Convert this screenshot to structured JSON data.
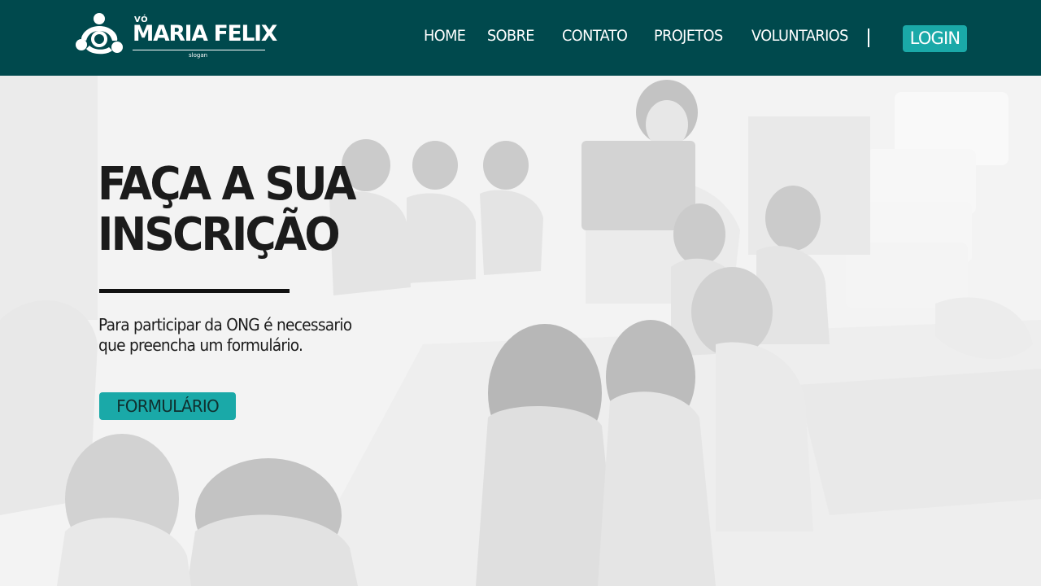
{
  "header": {
    "logo": {
      "prefix": "VÓ",
      "name": "MARIA FELIX",
      "slogan": "slogan",
      "icon": "people-circle-logo-icon"
    },
    "nav": [
      {
        "label": "HOME"
      },
      {
        "label": "SOBRE"
      },
      {
        "label": "CONTATO"
      },
      {
        "label": "PROJETOS"
      },
      {
        "label": "VOLUNTARIOS"
      }
    ],
    "login_label": "LOGIN"
  },
  "hero": {
    "background": "photo-children-sitting-in-circle-listening-to-reading",
    "title_line1": "FAÇA A SUA",
    "title_line2": "INSCRIÇÃO",
    "description_line1": "Para participar da ONG é necessario",
    "description_line2": "que preencha um formulário.",
    "button_label": "FORMULÁRIO"
  },
  "colors": {
    "header_bg": "#00494d",
    "accent": "#1aa9a8",
    "text_dark": "#1b1b1b",
    "text_light": "#ffffff"
  }
}
